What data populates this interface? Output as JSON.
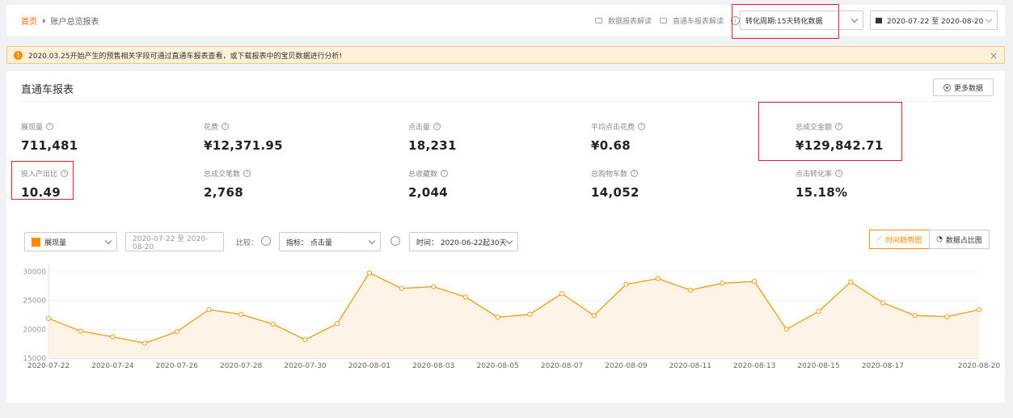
{
  "breadcrumb": {
    "home": "首页",
    "current": "账户总览报表"
  },
  "header": {
    "report_link_1": "数据报表解读",
    "report_link_2": "直通车报表解读",
    "conversion_period": "转化周期:15天转化数据",
    "date_range": "2020-07-22 至 2020-08-20"
  },
  "notice": {
    "text": "2020.03.25开始产生的预售相关字段可通过直通车报表查看，或下载报表中的宝贝数据进行分析!",
    "close": "×"
  },
  "panel": {
    "title": "直通车报表",
    "more_button": "更多数据"
  },
  "metrics": [
    {
      "label": "展现量",
      "value": "711,481"
    },
    {
      "label": "花费",
      "value": "¥12,371.95"
    },
    {
      "label": "点击量",
      "value": "18,231"
    },
    {
      "label": "平均点击花费",
      "value": "¥0.68"
    },
    {
      "label": "总成交金额",
      "value": "¥129,842.71"
    },
    {
      "label": "投入产出比",
      "value": "10.49"
    },
    {
      "label": "总成交笔数",
      "value": "2,768"
    },
    {
      "label": "总收藏数",
      "value": "2,044"
    },
    {
      "label": "总购物车数",
      "value": "14,052"
    },
    {
      "label": "点击转化率",
      "value": "15.18%"
    }
  ],
  "controls": {
    "metric_select": "展现量",
    "date_range": "2020-07-22 至 2020-08-20",
    "compare_label": "比较：",
    "indicator_select": "指标：  点击量",
    "time_select": "时间：  2020-06-22起30天",
    "tab_trend": "时间趋势图",
    "tab_share": "数据占比图"
  },
  "chart_data": {
    "type": "area",
    "series": [
      {
        "name": "展现量",
        "color": "#f0a020",
        "values": [
          21900,
          19700,
          18700,
          17600,
          19600,
          23400,
          22600,
          20900,
          18200,
          21000,
          29800,
          27100,
          27400,
          25600,
          22100,
          22600,
          26200,
          22400,
          27800,
          28800,
          26800,
          28000,
          28300,
          20000,
          23100,
          28200,
          24600,
          22400,
          22200,
          23400
        ]
      }
    ],
    "x": [
      "2020-07-22",
      "2020-07-23",
      "2020-07-24",
      "2020-07-25",
      "2020-07-26",
      "2020-07-27",
      "2020-07-28",
      "2020-07-29",
      "2020-07-30",
      "2020-07-31",
      "2020-08-01",
      "2020-08-02",
      "2020-08-03",
      "2020-08-04",
      "2020-08-05",
      "2020-08-06",
      "2020-08-07",
      "2020-08-08",
      "2020-08-09",
      "2020-08-10",
      "2020-08-11",
      "2020-08-12",
      "2020-08-13",
      "2020-08-14",
      "2020-08-15",
      "2020-08-16",
      "2020-08-17",
      "2020-08-18",
      "2020-08-19",
      "2020-08-20"
    ],
    "x_tick_labels": [
      "2020-07-22",
      "2020-07-24",
      "2020-07-26",
      "2020-07-28",
      "2020-07-30",
      "2020-08-01",
      "2020-08-03",
      "2020-08-05",
      "2020-08-07",
      "2020-08-09",
      "2020-08-11",
      "2020-08-13",
      "2020-08-15",
      "2020-08-17",
      "2020-08-20"
    ],
    "y_ticks": [
      15000,
      20000,
      25000,
      30000
    ],
    "ylim": [
      15000,
      30000
    ],
    "grid": true
  }
}
